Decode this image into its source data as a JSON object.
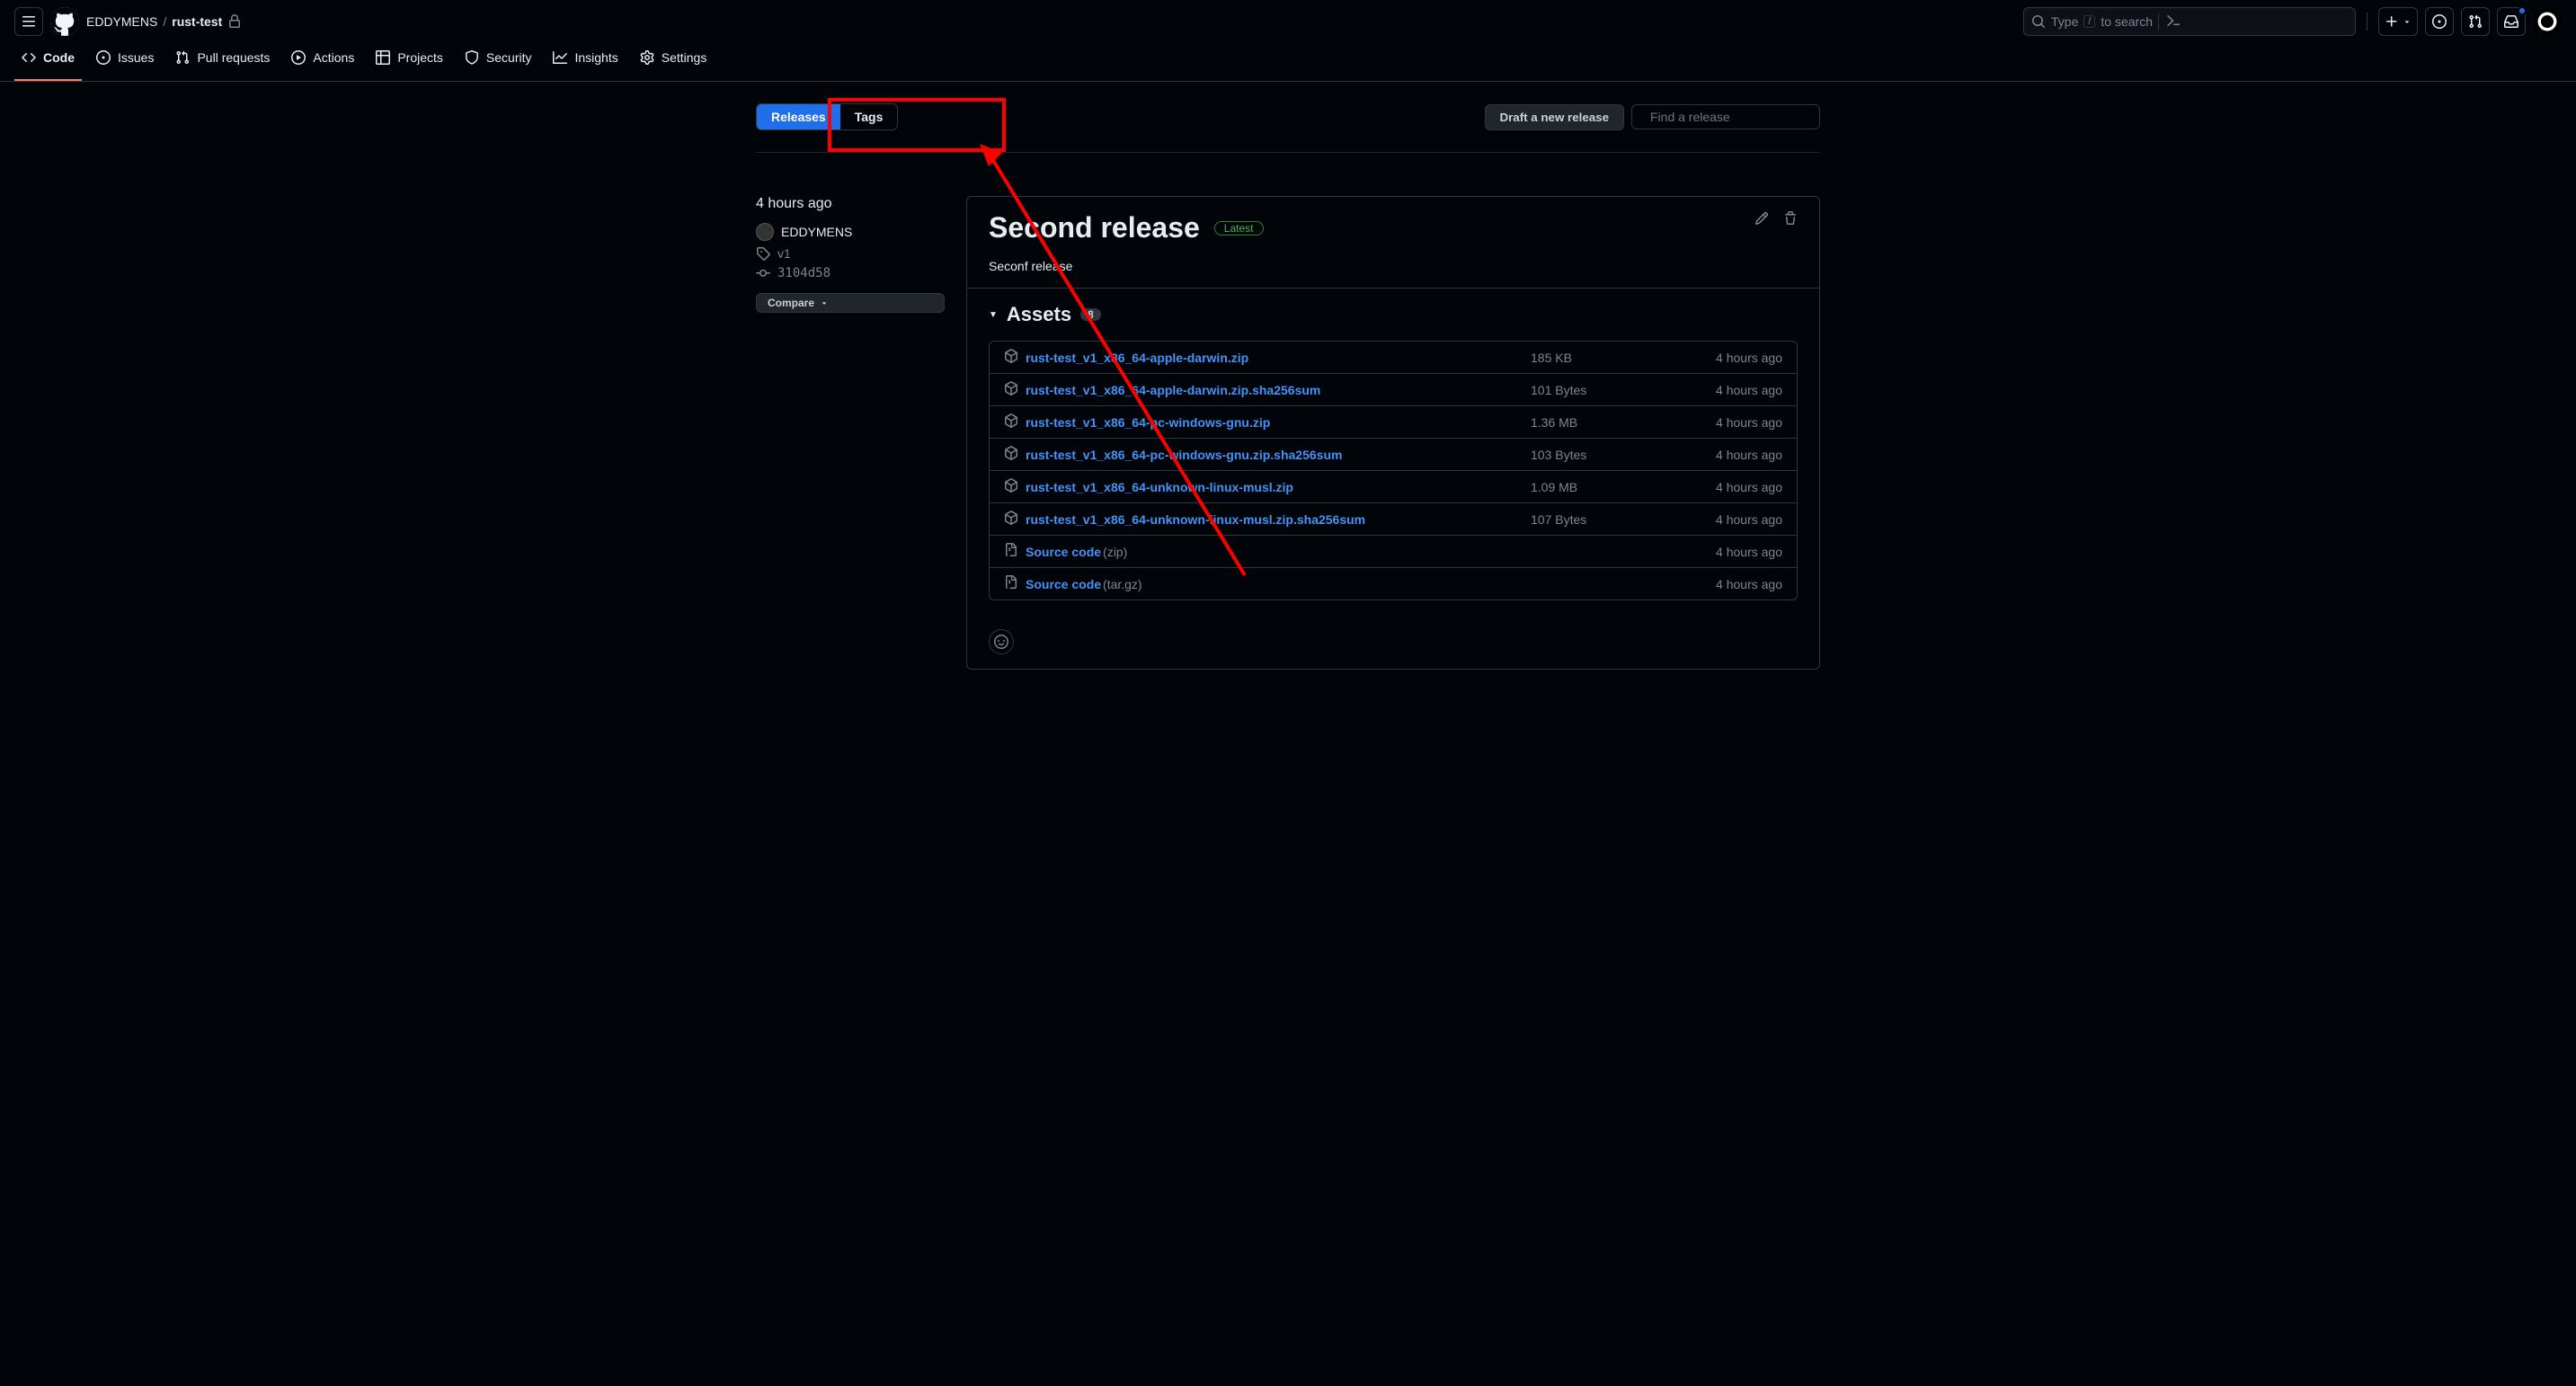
{
  "header": {
    "owner": "EDDYMENS",
    "repo": "rust-test",
    "search_prefix": "Type",
    "search_kbd": "/",
    "search_suffix": "to search"
  },
  "nav": {
    "code": "Code",
    "issues": "Issues",
    "pulls": "Pull requests",
    "actions": "Actions",
    "projects": "Projects",
    "security": "Security",
    "insights": "Insights",
    "settings": "Settings"
  },
  "subnav": {
    "releases": "Releases",
    "tags": "Tags",
    "draft_btn": "Draft a new release",
    "find_placeholder": "Find a release"
  },
  "release": {
    "time": "4 hours ago",
    "author": "EDDYMENS",
    "tag": "v1",
    "commit": "3104d58",
    "compare": "Compare",
    "title": "Second release",
    "latest_badge": "Latest",
    "description": "Seconf release",
    "assets_title": "Assets",
    "assets_count": "8",
    "assets": [
      {
        "name": "rust-test_v1_x86_64-apple-darwin.zip",
        "size": "185 KB",
        "date": "4 hours ago",
        "icon": "pkg"
      },
      {
        "name": "rust-test_v1_x86_64-apple-darwin.zip.sha256sum",
        "size": "101 Bytes",
        "date": "4 hours ago",
        "icon": "pkg"
      },
      {
        "name": "rust-test_v1_x86_64-pc-windows-gnu.zip",
        "size": "1.36 MB",
        "date": "4 hours ago",
        "icon": "pkg"
      },
      {
        "name": "rust-test_v1_x86_64-pc-windows-gnu.zip.sha256sum",
        "size": "103 Bytes",
        "date": "4 hours ago",
        "icon": "pkg"
      },
      {
        "name": "rust-test_v1_x86_64-unknown-linux-musl.zip",
        "size": "1.09 MB",
        "date": "4 hours ago",
        "icon": "pkg"
      },
      {
        "name": "rust-test_v1_x86_64-unknown-linux-musl.zip.sha256sum",
        "size": "107 Bytes",
        "date": "4 hours ago",
        "icon": "pkg"
      },
      {
        "name": "Source code",
        "ext": "(zip)",
        "size": "",
        "date": "4 hours ago",
        "icon": "zip"
      },
      {
        "name": "Source code",
        "ext": "(tar.gz)",
        "size": "",
        "date": "4 hours ago",
        "icon": "zip"
      }
    ]
  }
}
